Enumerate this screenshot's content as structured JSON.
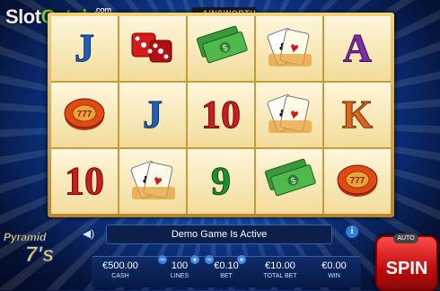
{
  "watermark": {
    "part1": "Slot",
    "part2": "Catalog",
    "part3": ".com"
  },
  "brand": {
    "name": "AINSWORTH"
  },
  "game_logo": {
    "line1": "Pyramid",
    "line2": "7's"
  },
  "status": {
    "message": "Demo Game Is Active"
  },
  "reels": [
    [
      {
        "symbol": "J",
        "kind": "letter",
        "color": "blue"
      },
      {
        "symbol": "dice",
        "kind": "icon"
      },
      {
        "symbol": "cash",
        "kind": "icon"
      },
      {
        "symbol": "cards",
        "kind": "icon"
      },
      {
        "symbol": "A",
        "kind": "letter",
        "color": "purple"
      }
    ],
    [
      {
        "symbol": "chip",
        "kind": "icon"
      },
      {
        "symbol": "J",
        "kind": "letter",
        "color": "blue"
      },
      {
        "symbol": "10",
        "kind": "letter",
        "color": "red"
      },
      {
        "symbol": "cards",
        "kind": "icon"
      },
      {
        "symbol": "K",
        "kind": "letter",
        "color": "orange"
      }
    ],
    [
      {
        "symbol": "10",
        "kind": "letter",
        "color": "red"
      },
      {
        "symbol": "cards",
        "kind": "icon"
      },
      {
        "symbol": "9",
        "kind": "letter",
        "color": "green"
      },
      {
        "symbol": "cash",
        "kind": "icon"
      },
      {
        "symbol": "chip",
        "kind": "icon"
      }
    ]
  ],
  "stats": [
    {
      "value": "€500.00",
      "label": "CASH"
    },
    {
      "value": "100",
      "label": "LINES"
    },
    {
      "value": "€0.10",
      "label": "BET"
    },
    {
      "value": "€10.00",
      "label": "TOTAL BET"
    },
    {
      "value": "€0.00",
      "label": "WIN"
    }
  ],
  "spin": {
    "label": "SPIN",
    "auto_label": "AUTO"
  },
  "colors": {
    "accent": "#c20e0e",
    "frame": "#d8a94c",
    "panel": "#0f2c6a"
  }
}
